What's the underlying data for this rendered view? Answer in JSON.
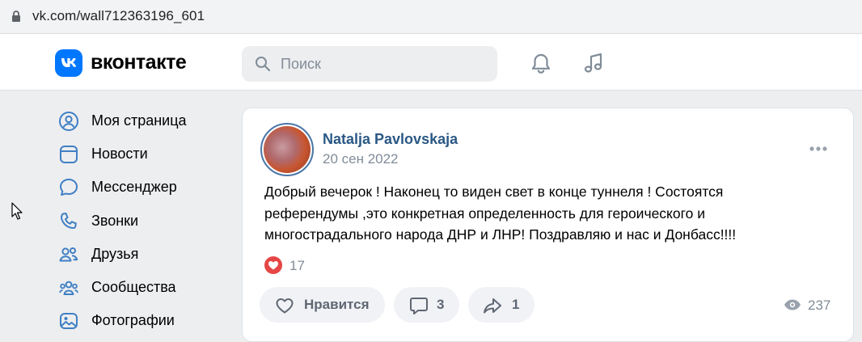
{
  "browser": {
    "url": "vk.com/wall712363196_601"
  },
  "header": {
    "logo_text": "вконтакте",
    "search_placeholder": "Поиск"
  },
  "sidebar": {
    "items": [
      {
        "label": "Моя страница",
        "icon": "profile-icon"
      },
      {
        "label": "Новости",
        "icon": "news-icon"
      },
      {
        "label": "Мессенджер",
        "icon": "messenger-icon"
      },
      {
        "label": "Звонки",
        "icon": "phone-icon"
      },
      {
        "label": "Друзья",
        "icon": "friends-icon"
      },
      {
        "label": "Сообщества",
        "icon": "communities-icon"
      },
      {
        "label": "Фотографии",
        "icon": "photos-icon"
      }
    ]
  },
  "post": {
    "author": "Natalja Pavlovskaja",
    "date": "20 сен 2022",
    "text_lines": [
      "Добрый вечерок ! Наконец то виден свет в конце туннеля ! Состоятся",
      "референдумы ,это конкретная определенность для героического и",
      "многострадального народа ДНР и ЛНР! Поздравляю и нас и Донбасс!!!!"
    ],
    "likes_count": "17",
    "like_label": "Нравится",
    "comments_count": "3",
    "shares_count": "1",
    "views_count": "237"
  },
  "colors": {
    "accent": "#0077ff",
    "link": "#2a5885",
    "like_red": "#e64646"
  }
}
